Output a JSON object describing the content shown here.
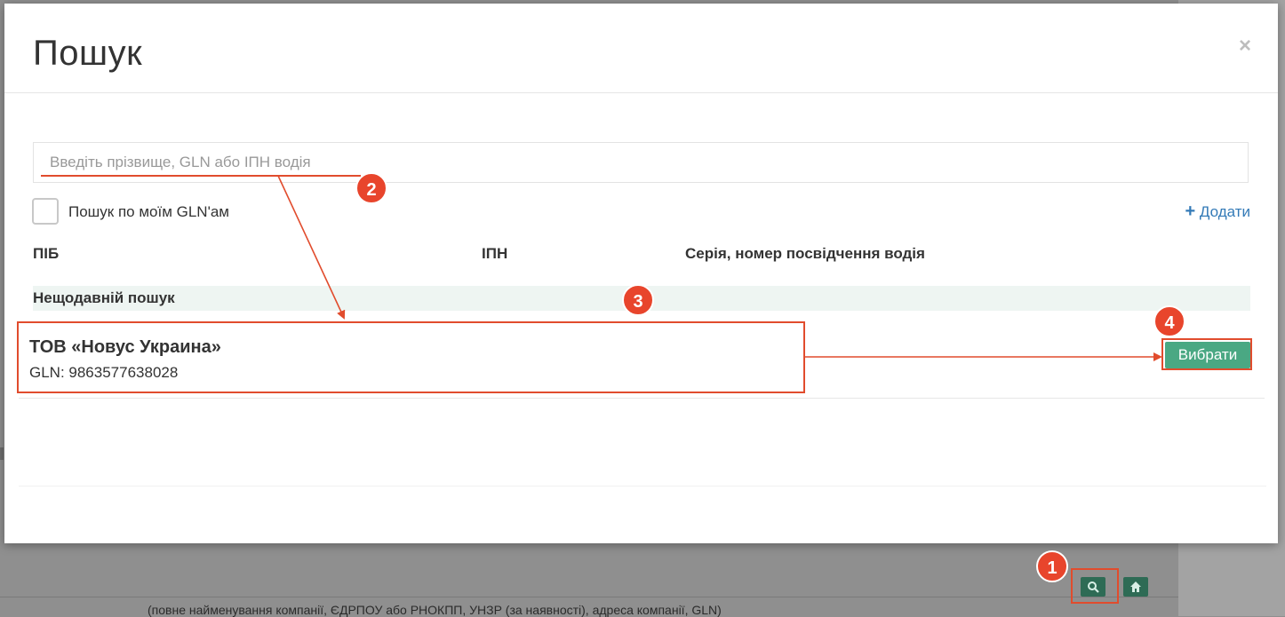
{
  "modal": {
    "title": "Пошук",
    "close_label": "×",
    "search_placeholder": "Введіть прізвище, GLN або ІПН водія",
    "search_value": "",
    "checkbox_label": "Пошук по моїм GLN'ам",
    "add_label": "Додати",
    "columns": {
      "pib": "ПІБ",
      "ipn": "ІПН",
      "series": "Серія, номер посвідчення водія"
    },
    "recent_label": "Нещодавній пошук",
    "result": {
      "name": "ТОВ «Новус Украина»",
      "gln": "GLN: 9863577638028"
    },
    "choose_label": "Вибрати"
  },
  "background": {
    "hint": "(повне найменування компанії, ЄДРПОУ або РНОКПП, УНЗР (за наявності), адреса компанії, GLN)"
  },
  "annotations": {
    "badge_1": "1",
    "badge_2": "2",
    "badge_3": "3",
    "badge_4": "4",
    "color": "#e8452c"
  },
  "icons": {
    "search": "search-icon",
    "home": "home-icon",
    "plus": "plus-icon",
    "close": "close-icon"
  }
}
